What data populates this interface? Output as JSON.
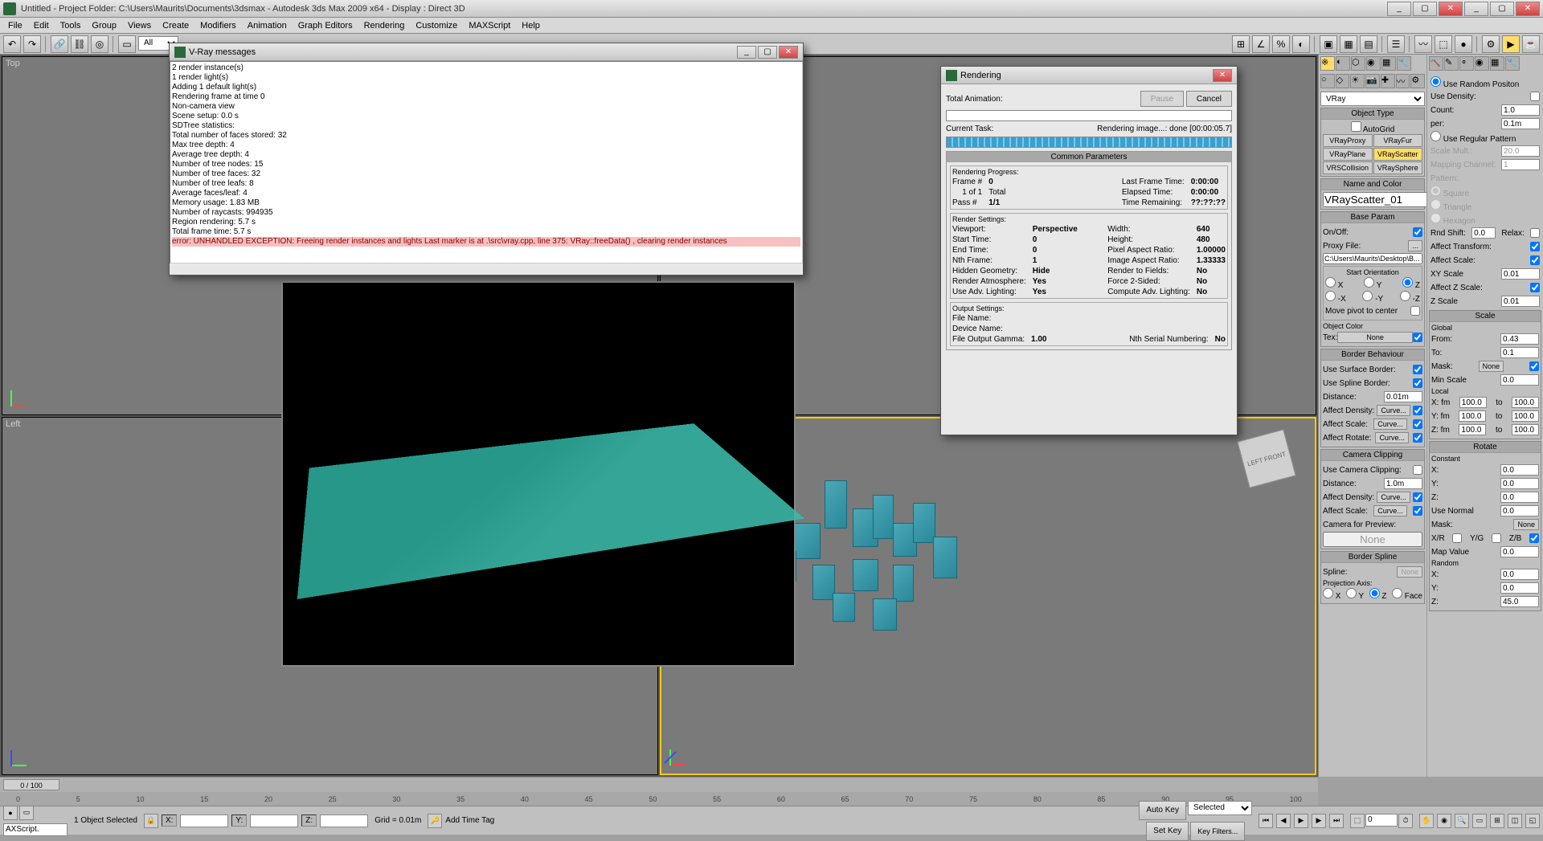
{
  "app": {
    "title": "Untitled     - Project Folder: C:\\Users\\Maurits\\Documents\\3dsmax     - Autodesk 3ds Max  2009 x64     - Display : Direct 3D"
  },
  "menu": [
    "File",
    "Edit",
    "Tools",
    "Group",
    "Views",
    "Create",
    "Modifiers",
    "Animation",
    "Graph Editors",
    "Rendering",
    "Customize",
    "MAXScript",
    "Help"
  ],
  "vray_dialog": {
    "title": "V-Ray messages",
    "lines": [
      "2 render instance(s)",
      "1 render light(s)",
      "Adding 1 default light(s)",
      "Rendering frame at time 0",
      "Non-camera view",
      "Scene setup: 0.0 s",
      "SDTree statistics:",
      "Total number of faces stored: 32",
      "Max tree depth: 4",
      "Average tree depth: 4",
      "Number of tree nodes: 15",
      "Number of tree faces: 32",
      "Number of tree leafs: 8",
      "Average faces/leaf: 4",
      "Memory usage: 1.83 MB",
      "Number of raycasts: 994935",
      "Region rendering: 5.7 s",
      "Total frame time: 5.7 s"
    ],
    "error": "error: UNHANDLED EXCEPTION: Freeing render instances and lights  Last marker is at .\\src\\vray.cpp, line 375: VRay::freeData() , clearing render instances"
  },
  "render_dialog": {
    "title": "Rendering",
    "pause": "Pause",
    "cancel": "Cancel",
    "total_anim_label": "Total Animation:",
    "current_task_label": "Current Task:",
    "current_task": "Rendering image...: done [00:00:05.7]",
    "common_params_title": "Common Parameters",
    "rendering_progress_title": "Rendering Progress:",
    "frame_label": "Frame #",
    "frame": "0",
    "of_label": "1 of 1",
    "total_label": "Total",
    "pass_label": "Pass #",
    "pass": "1/1",
    "last_frame_time_label": "Last Frame Time:",
    "last_frame_time": "0:00:00",
    "elapsed_label": "Elapsed Time:",
    "elapsed": "0:00:00",
    "remaining_label": "Time Remaining:",
    "remaining": "??:??:??",
    "render_settings_title": "Render Settings:",
    "viewport_label": "Viewport:",
    "viewport": "Perspective",
    "start_time_label": "Start Time:",
    "start_time": "0",
    "end_time_label": "End Time:",
    "end_time": "0",
    "nth_frame_label": "Nth Frame:",
    "nth_frame": "1",
    "hidden_geom_label": "Hidden Geometry:",
    "hidden_geom": "Hide",
    "render_atmos_label": "Render Atmosphere:",
    "render_atmos": "Yes",
    "adv_lighting_label": "Use Adv. Lighting:",
    "adv_lighting": "Yes",
    "width_label": "Width:",
    "width": "640",
    "height_label": "Height:",
    "height": "480",
    "par_label": "Pixel Aspect Ratio:",
    "par": "1.00000",
    "iar_label": "Image Aspect Ratio:",
    "iar": "1.33333",
    "rtf_label": "Render to Fields:",
    "rtf": "No",
    "f2s_label": "Force 2-Sided:",
    "f2s": "No",
    "cal_label": "Compute Adv. Lighting:",
    "cal": "No",
    "output_title": "Output Settings:",
    "file_name_label": "File Name:",
    "device_name_label": "Device Name:",
    "gamma_label": "File Output Gamma:",
    "gamma": "1.00",
    "serial_label": "Nth Serial Numbering:",
    "serial": "No"
  },
  "command_panel": {
    "renderer_dropdown": "VRay",
    "obj_type_title": "Object Type",
    "autogrid": "AutoGrid",
    "buttons": [
      "VRayProxy",
      "VRayFur",
      "VRayPlane",
      "VRayScatter",
      "VRSCollision",
      "VRaySphere"
    ],
    "selected_button": "VRayScatter",
    "name_color_title": "Name and Color",
    "object_name": "VRayScatter_01",
    "base_param_title": "Base Param",
    "onoff": "On/Off:",
    "proxy_file": "Proxy File:",
    "proxy_path": "C:\\Users\\Maurits\\Desktop\\B...",
    "start_orient_title": "Start Orientation",
    "move_pivot": "Move pivot to center",
    "obj_color": "Object Color",
    "tex_label": "Tex:",
    "tex_btn": "None",
    "border_beh_title": "Border Behaviour",
    "use_surface": "Use Surface Border:",
    "use_spline": "Use Spline Border:",
    "distance": "Distance:",
    "distance_val": "0.01m",
    "affect_density": "Affect Density:",
    "affect_scale": "Affect Scale:",
    "affect_rotate": "Affect Rotate:",
    "curve": "Curve...",
    "camera_clip_title": "Camera Clipping",
    "use_camera": "Use Camera Clipping:",
    "cam_distance": "Distance:",
    "cam_distance_val": "1.0m",
    "camera_preview": "Camera for Preview:",
    "none": "None",
    "border_spline_title": "Border Spline",
    "spline_label": "Spline:",
    "proj_axis": "Projection Axis:",
    "face_label": "Face"
  },
  "right_panel": {
    "use_random": "Use Random Positon",
    "use_density": "Use Density:",
    "count": "Count:",
    "count_val": "1.0",
    "per": "per:",
    "per_val": "0.1m",
    "use_regular": "Use Regular Pattern",
    "scale_mult": "Scale Mult.:",
    "scale_mult_val": "20.0",
    "mapping": "Mapping Channel:",
    "mapping_val": "1",
    "pattern": "Pattern:",
    "square": "Square",
    "triangle": "Triangle",
    "hexagon": "Hexagon",
    "rnd_shift": "Rnd Shift:",
    "rnd_shift_val": "0.0",
    "relax": "Relax:",
    "affect_transform": "Affect Transform:",
    "affect_scale": "Affect Scale:",
    "xy_scale": "XY Scale",
    "xy_scale_val": "0.01",
    "affect_z": "Affect Z Scale:",
    "z_scale": "Z Scale",
    "z_scale_val": "0.01",
    "scale_title": "Scale",
    "global": "Global",
    "from": "From:",
    "from_val": "0.43",
    "to": "To:",
    "to_val": "0.1",
    "mask": "Mask:",
    "none": "None",
    "min_scale": "Min Scale",
    "min_scale_val": "0.0",
    "local": "Local",
    "x_fm": "X: fm",
    "y_fm": "Y: fm",
    "z_fm": "Z: fm",
    "val100": "100.0",
    "to_lbl": "to",
    "rotate_title": "Rotate",
    "constant": "Constant",
    "x": "X:",
    "y": "Y:",
    "z": "Z:",
    "val0": "0.0",
    "use_normal": "Use Normal",
    "xr": "X/R",
    "yg": "Y/G",
    "zb": "Z/B",
    "map_value": "Map Value",
    "random": "Random",
    "z45": "45.0"
  },
  "viewports": {
    "top": "Top",
    "left": "Left",
    "viewcube": "LEFT  FRONT"
  },
  "timeline": {
    "frame": "0 / 100",
    "ticks": [
      "0",
      "5",
      "10",
      "15",
      "20",
      "25",
      "30",
      "35",
      "40",
      "45",
      "50",
      "55",
      "60",
      "65",
      "70",
      "75",
      "80",
      "85",
      "90",
      "95",
      "100"
    ]
  },
  "status": {
    "maxscript": "AXScript.",
    "sel": "1 Object Selected",
    "x": "X:",
    "y": "Y:",
    "z": "Z:",
    "grid": "Grid = 0.01m",
    "add_tag": "Add Time Tag",
    "auto_key": "Auto Key",
    "set_key": "Set Key",
    "selected": "Selected",
    "key_filters": "Key Filters..."
  }
}
